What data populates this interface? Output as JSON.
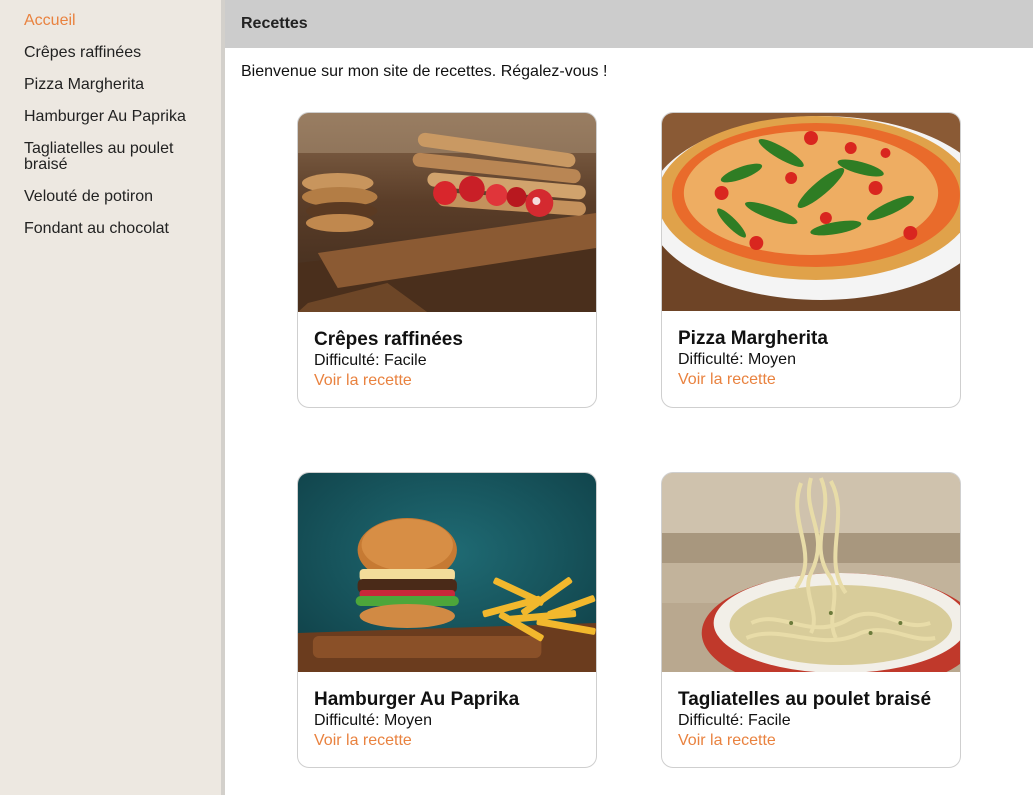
{
  "sidebar": {
    "items": [
      {
        "label": "Accueil"
      },
      {
        "label": "Crêpes raffinées"
      },
      {
        "label": "Pizza Margherita"
      },
      {
        "label": "Hamburger Au Paprika"
      },
      {
        "label": "Tagliatelles au poulet braisé"
      },
      {
        "label": "Velouté de potiron"
      },
      {
        "label": "Fondant au chocolat"
      }
    ]
  },
  "header": {
    "title": "Recettes"
  },
  "main": {
    "welcome": "Bienvenue sur mon site de recettes. Régalez-vous !",
    "difficulty_label": "Difficulté:",
    "recipes": [
      {
        "title": "Crêpes raffinées",
        "difficulty": "Difficulté: Facile",
        "link": "Voir la recette"
      },
      {
        "title": "Pizza Margherita",
        "difficulty": "Difficulté: Moyen",
        "link": "Voir la recette"
      },
      {
        "title": "Hamburger Au Paprika",
        "difficulty": "Difficulté: Moyen",
        "link": "Voir la recette"
      },
      {
        "title": "Tagliatelles au poulet braisé",
        "difficulty": "Difficulté: Facile",
        "link": "Voir la recette"
      }
    ]
  },
  "colors": {
    "accent": "#e9823f",
    "sidebar_bg": "#ede8e1",
    "topbar_bg": "#cccccc"
  }
}
